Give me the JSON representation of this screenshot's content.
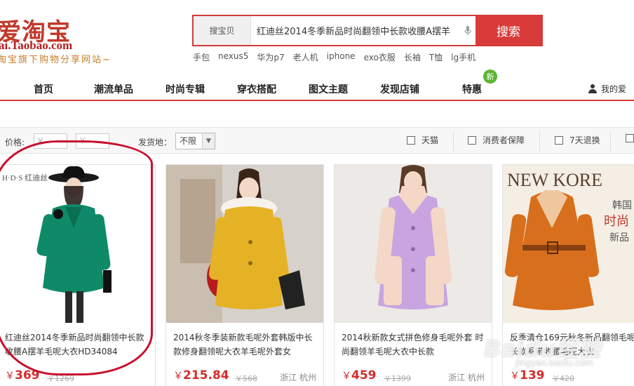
{
  "header": {
    "logo_text": "爱淘宝",
    "logo_url": "ai.Taobao.com",
    "logo_slogan": "淘宝旗下购物分享网站~"
  },
  "search": {
    "scope": "搜宝贝",
    "value": "红迪丝2014冬季新品时尚翻领中长款收腰A摆羊",
    "button": "搜索",
    "hot_tags": [
      "手包",
      "nexus5",
      "华为p7",
      "老人机",
      "iphone",
      "exo衣服",
      "长袖",
      "T恤",
      "lg手机"
    ]
  },
  "nav": {
    "items": [
      "首页",
      "潮流单品",
      "时尚专辑",
      "穿衣搭配",
      "图文主题",
      "发现店铺",
      "特惠"
    ],
    "new_badge": "新",
    "user_label": "我的爱"
  },
  "filters": {
    "price_label": "价格:",
    "price_min_placeholder": "￥",
    "price_max_placeholder": "￥",
    "dash": "-",
    "origin_label": "发货地：",
    "origin_value": "不限",
    "checks": [
      "天猫",
      "消费者保障",
      "7天退换"
    ]
  },
  "products": [
    {
      "title": "红迪丝2014冬季新品时尚翻领中长款收腰A摆羊毛呢大衣HD34084",
      "price": "369",
      "old_price": "1269",
      "location": "",
      "brand_tag": "H·D·S 红迪丝"
    },
    {
      "title": "2014秋冬季装新款毛呢外套韩版中长款修身翻领呢大衣羊毛呢外套女",
      "price": "215.84",
      "old_price": "568",
      "location": "浙江 杭州"
    },
    {
      "title": "2014秋新款女式拼色修身毛呢外套 时尚翻领羊毛呢大衣中长款",
      "price": "459",
      "old_price": "1399",
      "location": "浙江 杭州"
    },
    {
      "title": "反季清仓169元秋冬新品翻领毛呢女中长款系带收腰毛呢大衣",
      "price": "139",
      "old_price": "420",
      "location": "",
      "banner_top": "NEW KORE",
      "banner_side": [
        "韩国",
        "时尚",
        "新品"
      ]
    }
  ],
  "currency": "￥",
  "watermark": "Baidu经验",
  "watermark_sub": "jingyan.baidu.com",
  "colors": {
    "brand_red": "#d93b3b",
    "price_red": "#d42d2d",
    "new_badge_green": "#5cb531"
  }
}
